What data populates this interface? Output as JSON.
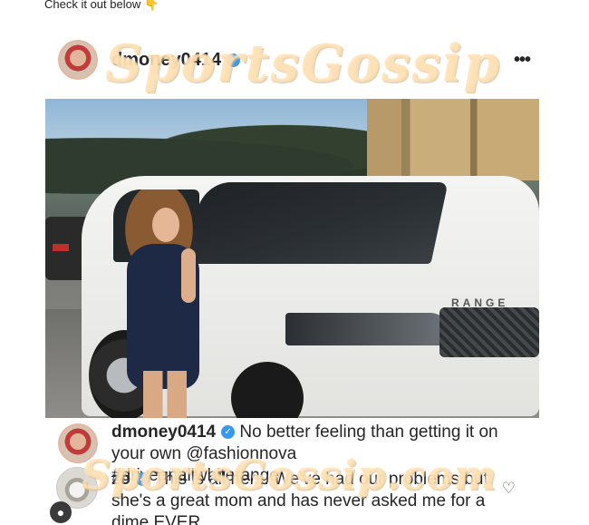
{
  "intro": {
    "text": "Check it out below",
    "emoji": "👇"
  },
  "post": {
    "username": "dmoney0414",
    "more": "•••",
    "caption": {
      "username": "dmoney0414",
      "text": "No better feeling than getting it on your own",
      "mention": "@fashionnova",
      "hashtag": "#driveanallwhiterange"
    },
    "photo_text": "RANGE",
    "comment": {
      "username": "zo",
      "text": "This is all her... We've had our problems but she's a great mom and has never asked me for a dime EVER"
    }
  },
  "watermarks": {
    "top": "SportsGossip",
    "bottom": "SportsGossip.com"
  },
  "colors": {
    "verified": "#3897f0",
    "watermark": "#ffd28c"
  }
}
